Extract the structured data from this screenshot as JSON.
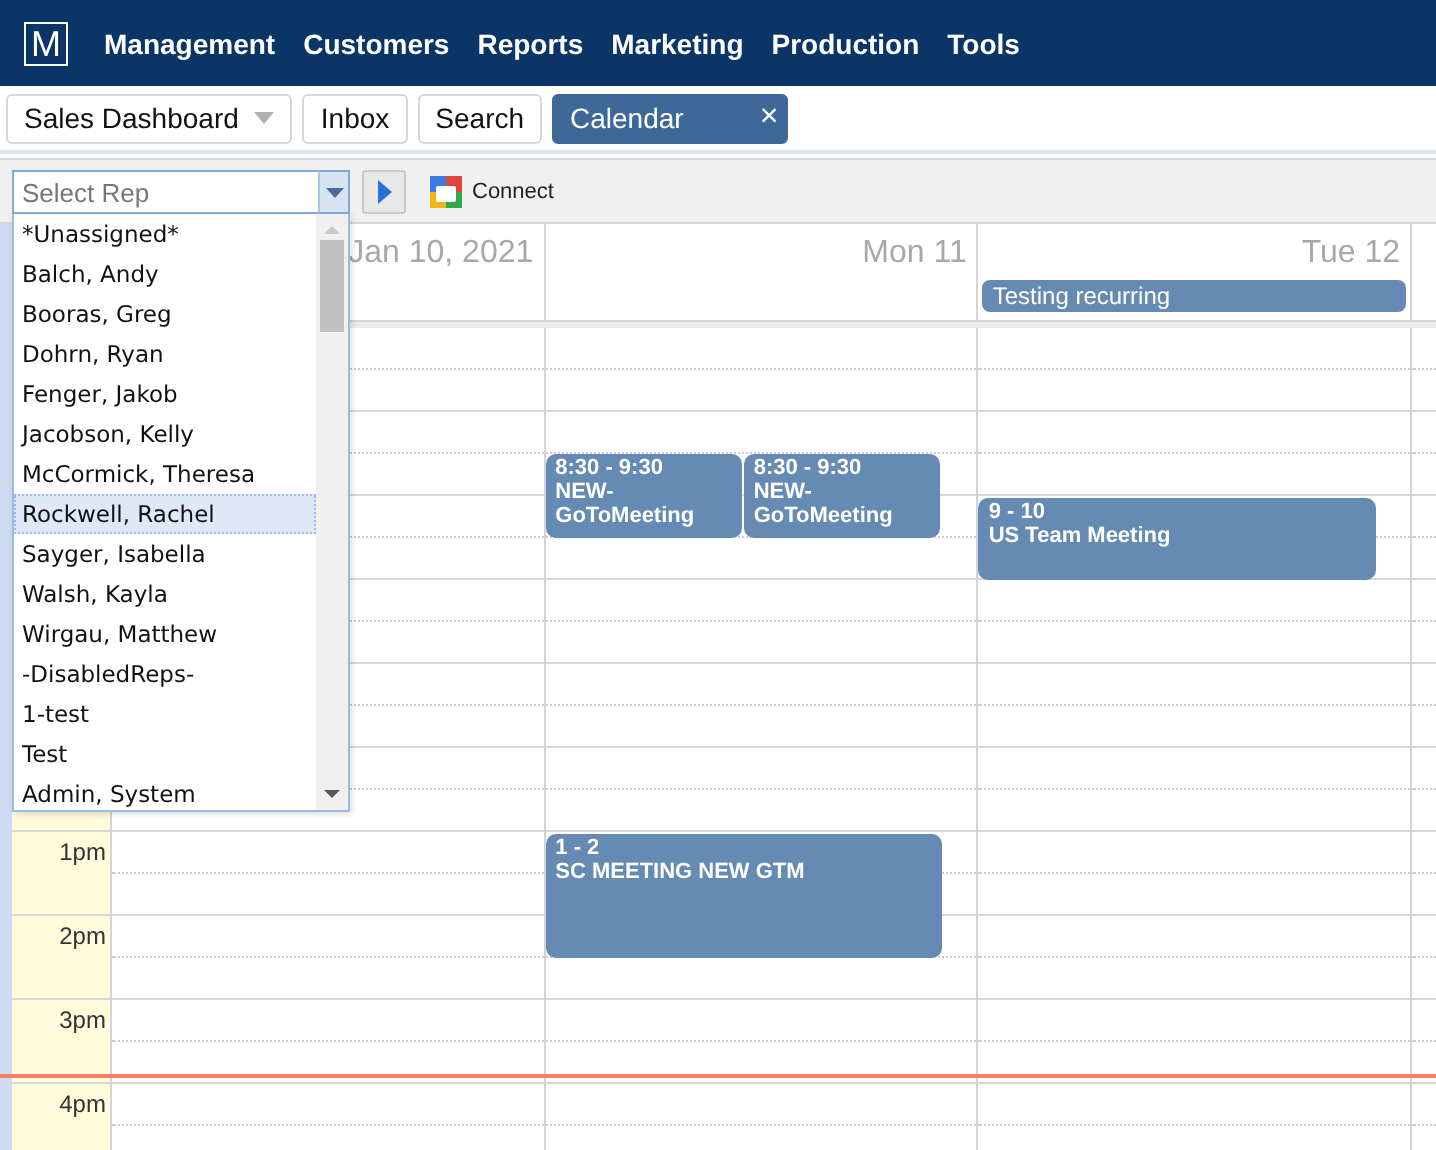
{
  "nav": {
    "logo": "M",
    "items": [
      "Management",
      "Customers",
      "Reports",
      "Marketing",
      "Production",
      "Tools"
    ]
  },
  "tabs": [
    {
      "label": "Sales Dashboard",
      "kind": "dropdown",
      "selected": false
    },
    {
      "label": "Inbox",
      "kind": "plain",
      "selected": false
    },
    {
      "label": "Search",
      "kind": "plain",
      "selected": false
    },
    {
      "label": "Calendar",
      "kind": "closable",
      "selected": true,
      "close": "×"
    }
  ],
  "toolbar": {
    "rep_select": {
      "placeholder": "Select Rep",
      "options": [
        {
          "label": "*Unassigned*",
          "selected": false
        },
        {
          "label": "Balch, Andy",
          "selected": false
        },
        {
          "label": "Booras, Greg",
          "selected": false
        },
        {
          "label": "Dohrn, Ryan",
          "selected": false
        },
        {
          "label": "Fenger, Jakob",
          "selected": false
        },
        {
          "label": "Jacobson, Kelly",
          "selected": false
        },
        {
          "label": "McCormick, Theresa",
          "selected": false
        },
        {
          "label": "Rockwell, Rachel",
          "selected": true
        },
        {
          "label": "Sayger, Isabella",
          "selected": false
        },
        {
          "label": "Walsh, Kayla",
          "selected": false
        },
        {
          "label": "Wirgau, Matthew",
          "selected": false
        },
        {
          "label": "-DisabledReps-",
          "selected": false
        },
        {
          "label": "1-test",
          "selected": false
        },
        {
          "label": "Test",
          "selected": false
        },
        {
          "label": "Admin, System",
          "selected": false
        }
      ]
    },
    "connect": "Connect"
  },
  "calendar": {
    "days": [
      {
        "header": "Jan 10, 2021"
      },
      {
        "header": "Mon 11",
        "events": [
          {
            "time": "8:30 - 9:30",
            "title": "NEW-GoToMeeting"
          },
          {
            "time": "8:30 - 9:30",
            "title": "NEW-GoToMeeting"
          },
          {
            "time": "1 - 2",
            "title": "SC MEETING NEW GTM"
          }
        ]
      },
      {
        "header": "Tue 12",
        "all_day": [
          "Testing recurring"
        ],
        "events": [
          {
            "time": "9 - 10",
            "title": "US Team Meeting"
          }
        ]
      }
    ],
    "hour_labels": [
      "1pm",
      "2pm",
      "3pm",
      "4pm"
    ]
  }
}
